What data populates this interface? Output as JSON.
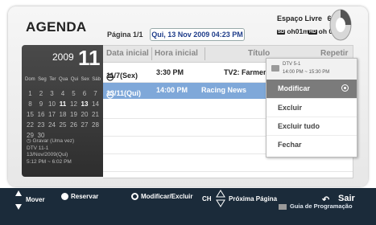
{
  "header": {
    "title": "AGENDA",
    "page": "Página 1/1",
    "datetime": "Qui, 13 Nov 2009 04:23 PM",
    "space_label": "Espaço Livre",
    "space_value": "64MB",
    "sd_tag": "SD",
    "sd_value": "oh01m",
    "hd_tag": "HD",
    "hd_value": "oh 01m"
  },
  "calendar": {
    "year": "2009",
    "month": "11",
    "weekdays": [
      "Dom",
      "Seg",
      "Ter",
      "Qua",
      "Qui",
      "Sex",
      "Sáb"
    ],
    "weeks": [
      [
        "1",
        "2",
        "3",
        "4",
        "5",
        "6",
        "7"
      ],
      [
        "8",
        "9",
        "10",
        "11",
        "12",
        "13",
        "14"
      ],
      [
        "15",
        "16",
        "17",
        "18",
        "19",
        "20",
        "21"
      ],
      [
        "22",
        "23",
        "24",
        "25",
        "26",
        "27",
        "28"
      ],
      [
        "29",
        "30",
        "",
        "",
        "",
        "",
        ""
      ]
    ],
    "highlight_days": [
      "11",
      "13"
    ],
    "info_lines": [
      "Gravar (Uma vez)",
      "DTV 11-1",
      "13/Nov/2009(Qui)",
      "5:12 PM ~ 6:02 PM"
    ]
  },
  "table": {
    "columns": [
      "Data inicial",
      "Hora inicial",
      "Título",
      "Repetir"
    ],
    "rows": [
      {
        "date": "11/7(Sex)",
        "time": "3:30 PM",
        "title": "TV2: Farmen"
      },
      {
        "date": "13/11(Qui)",
        "time": "14:00 PM",
        "title": "Racing News"
      }
    ]
  },
  "menu": {
    "channel": "DTV 5-1",
    "time": "14:00 PM ~ 15:30 PM",
    "items": [
      "Modificar",
      "Excluir",
      "Excluir tudo",
      "Fechar"
    ],
    "selected": "Modificar"
  },
  "footer": {
    "move": "Mover",
    "reserve": "Reservar",
    "modify": "Modificar/Excluir",
    "ch": "CH",
    "next_page": "Próxima Página",
    "exit": "Sair",
    "guide": "Guia de Programação"
  },
  "colors": {
    "selected_row": "#7fa8d9",
    "footer_bg": "#1b2b3a",
    "calendar_bg": "#3a3a3a",
    "menu_selected": "#7b7b7b"
  }
}
